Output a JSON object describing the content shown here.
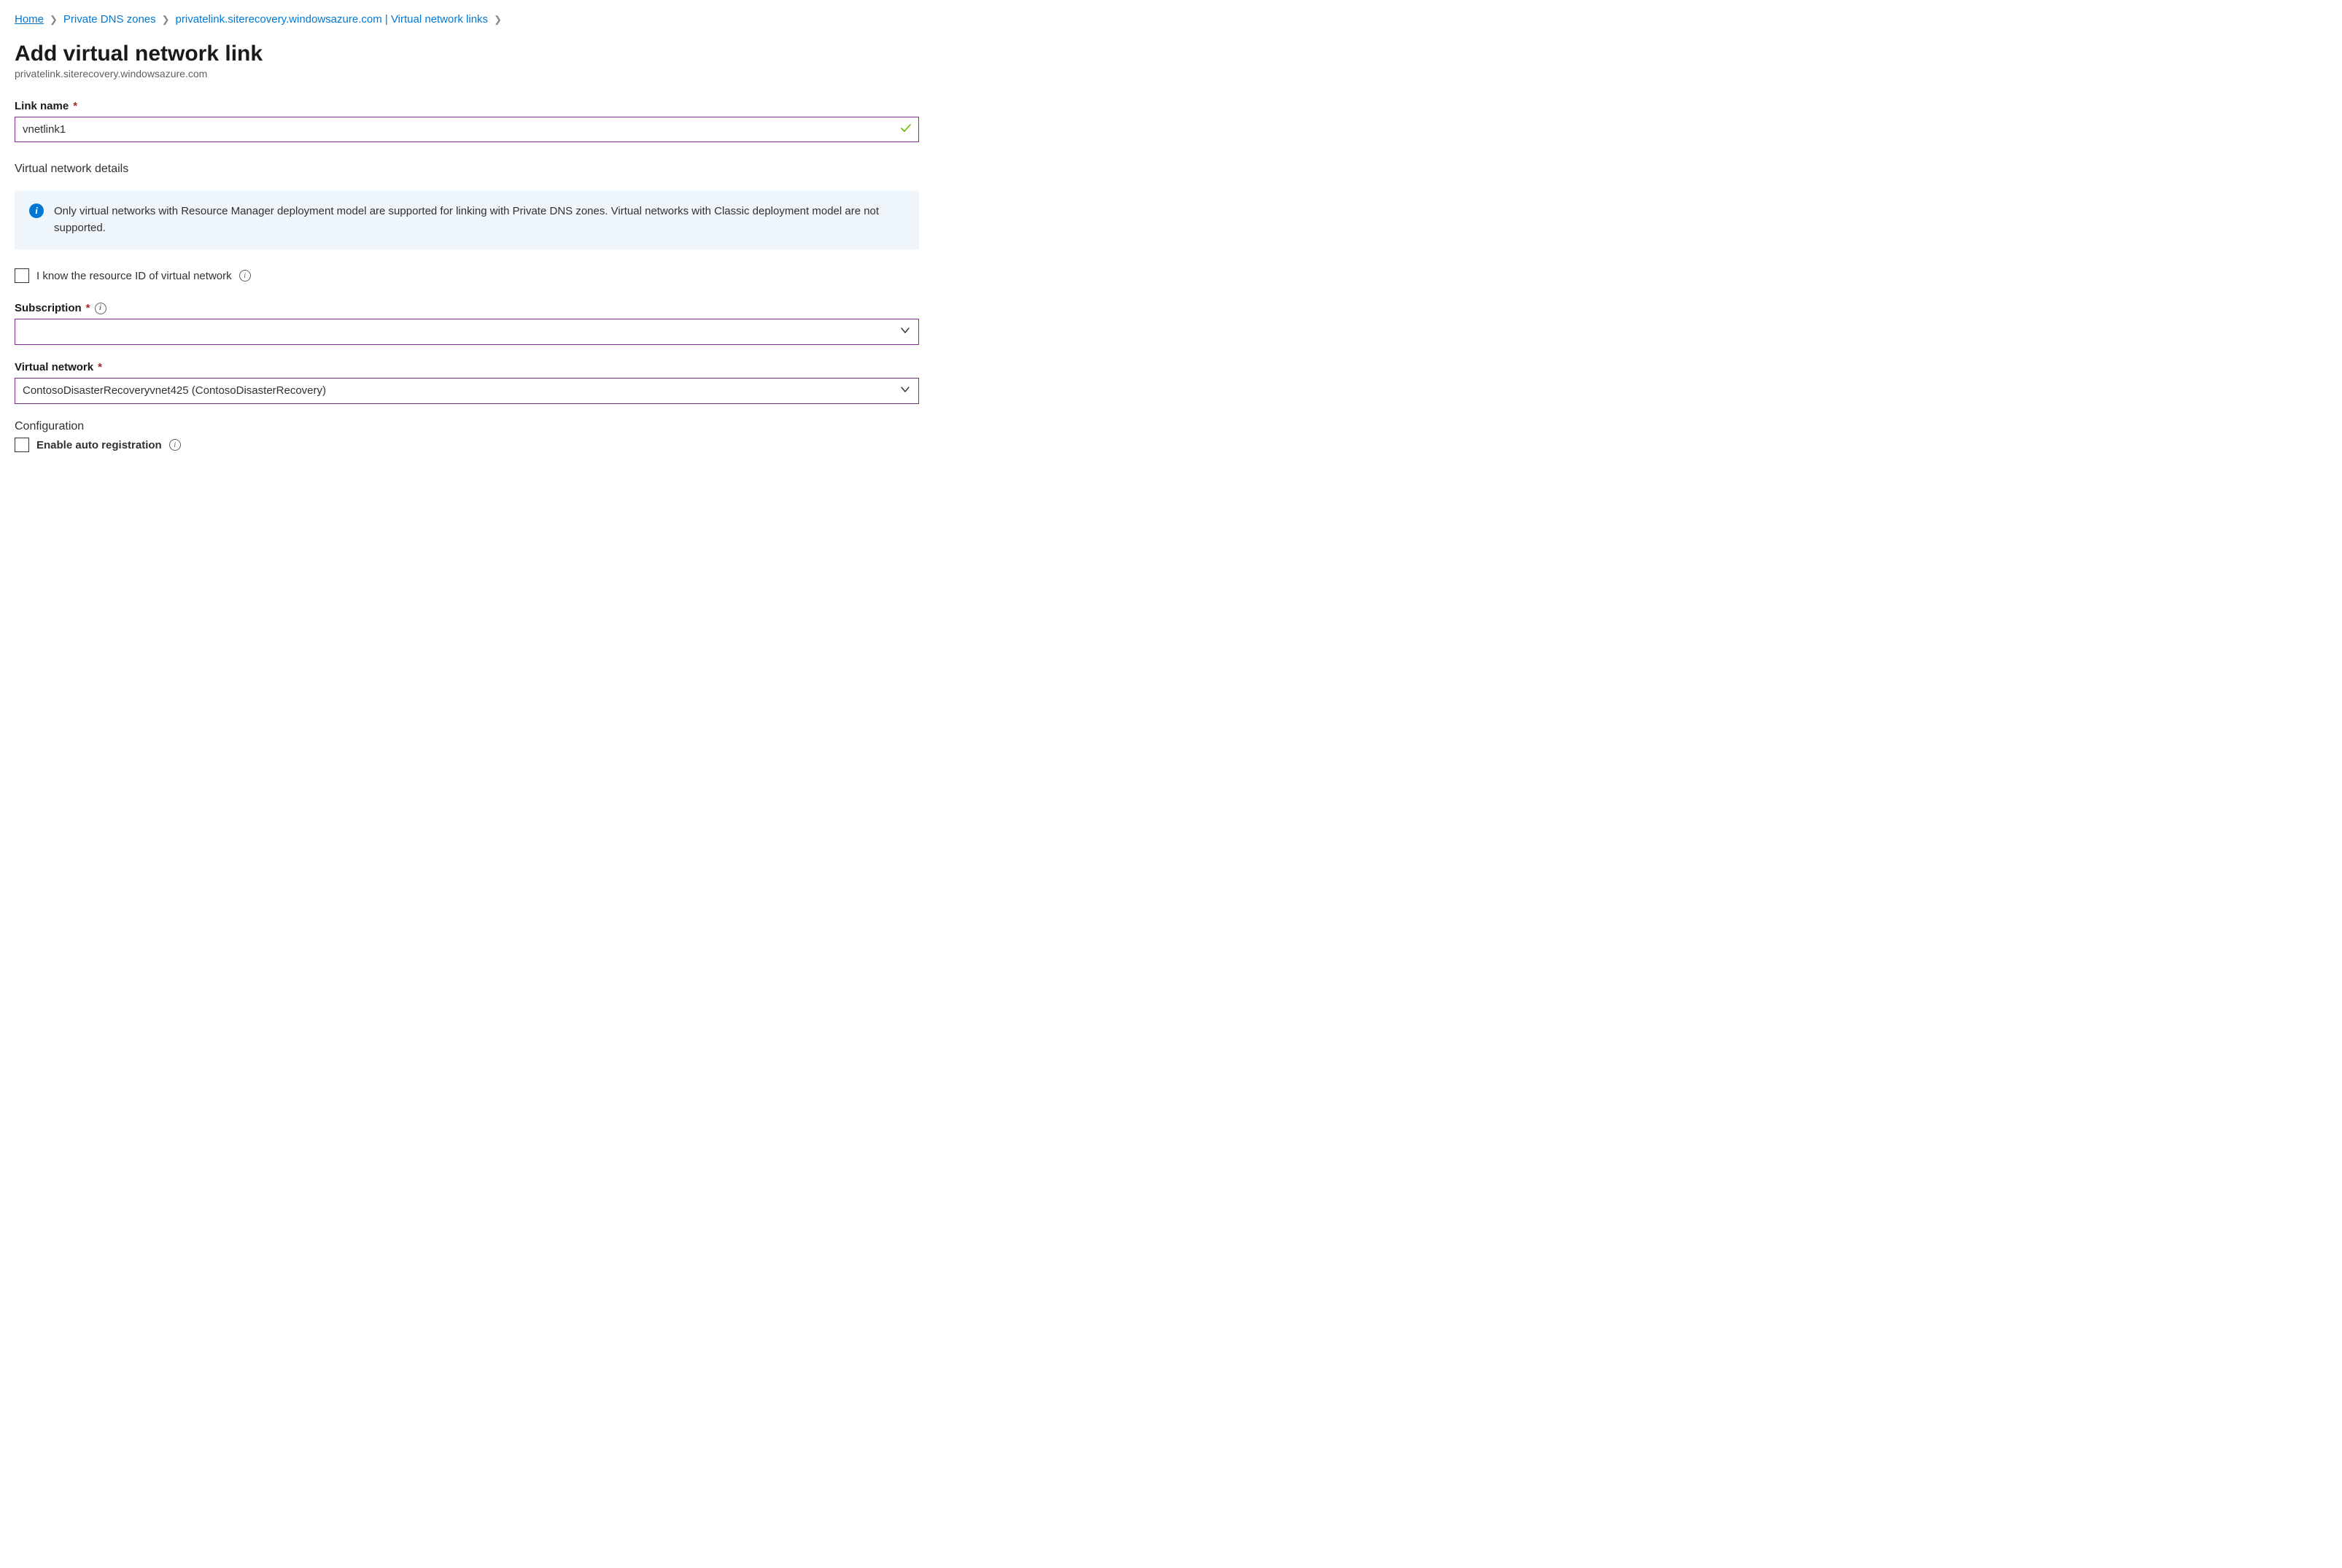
{
  "breadcrumb": {
    "items": [
      {
        "label": "Home"
      },
      {
        "label": "Private DNS zones"
      },
      {
        "label": "privatelink.siterecovery.windowsazure.com | Virtual network links"
      }
    ]
  },
  "page": {
    "title": "Add virtual network link",
    "subtitle": "privatelink.siterecovery.windowsazure.com"
  },
  "form": {
    "link_name": {
      "label": "Link name",
      "value": "vnetlink1"
    },
    "vnet_details_heading": "Virtual network details",
    "info_banner": "Only virtual networks with Resource Manager deployment model are supported for linking with Private DNS zones. Virtual networks with Classic deployment model are not supported.",
    "know_resource_id_label": "I know the resource ID of virtual network",
    "subscription": {
      "label": "Subscription",
      "value": ""
    },
    "virtual_network": {
      "label": "Virtual network",
      "value": "ContosoDisasterRecoveryvnet425 (ContosoDisasterRecovery)"
    },
    "configuration_heading": "Configuration",
    "auto_registration_label": "Enable auto registration"
  }
}
